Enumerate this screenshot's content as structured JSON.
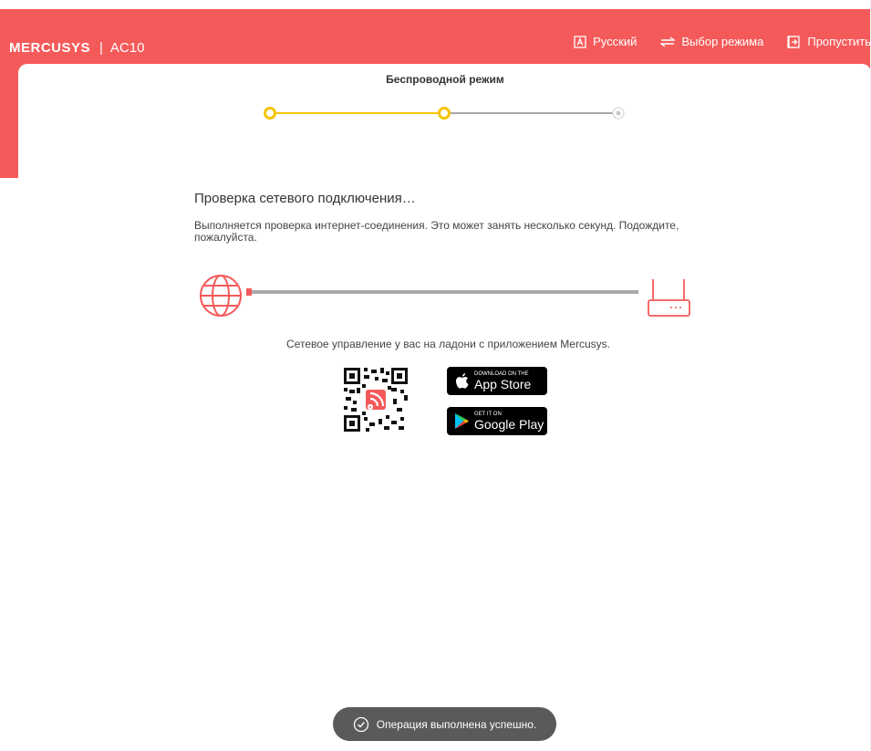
{
  "header": {
    "logo": "MERCUSYS",
    "separator": "|",
    "model": "AC10",
    "nav": [
      {
        "label": "Русский",
        "icon": "language-icon"
      },
      {
        "label": "Выбор режима",
        "icon": "swap-icon"
      },
      {
        "label": "Пропустить",
        "icon": "skip-icon"
      }
    ]
  },
  "wizard": {
    "current_step_label": "Беспроводной режим",
    "steps_total": 3,
    "steps_completed": 2
  },
  "main": {
    "title": "Проверка сетевого подключения…",
    "description": "Выполняется проверка интернет-соединения. Это может занять несколько секунд. Подождите, пожалуйста."
  },
  "promo": {
    "text": "Сетевое управление у вас на ладони с приложением Mercusys.",
    "appstore": {
      "small": "DOWNLOAD ON THE",
      "big": "App Store"
    },
    "googleplay": {
      "small": "GET IT ON",
      "big": "Google Play"
    }
  },
  "toast": {
    "text": "Операция выполнена успешно."
  },
  "colors": {
    "accent": "#f55a5a",
    "step_active": "#f5c400",
    "line_gray": "#a8a8a8",
    "toast_bg": "#5a5a5a"
  }
}
